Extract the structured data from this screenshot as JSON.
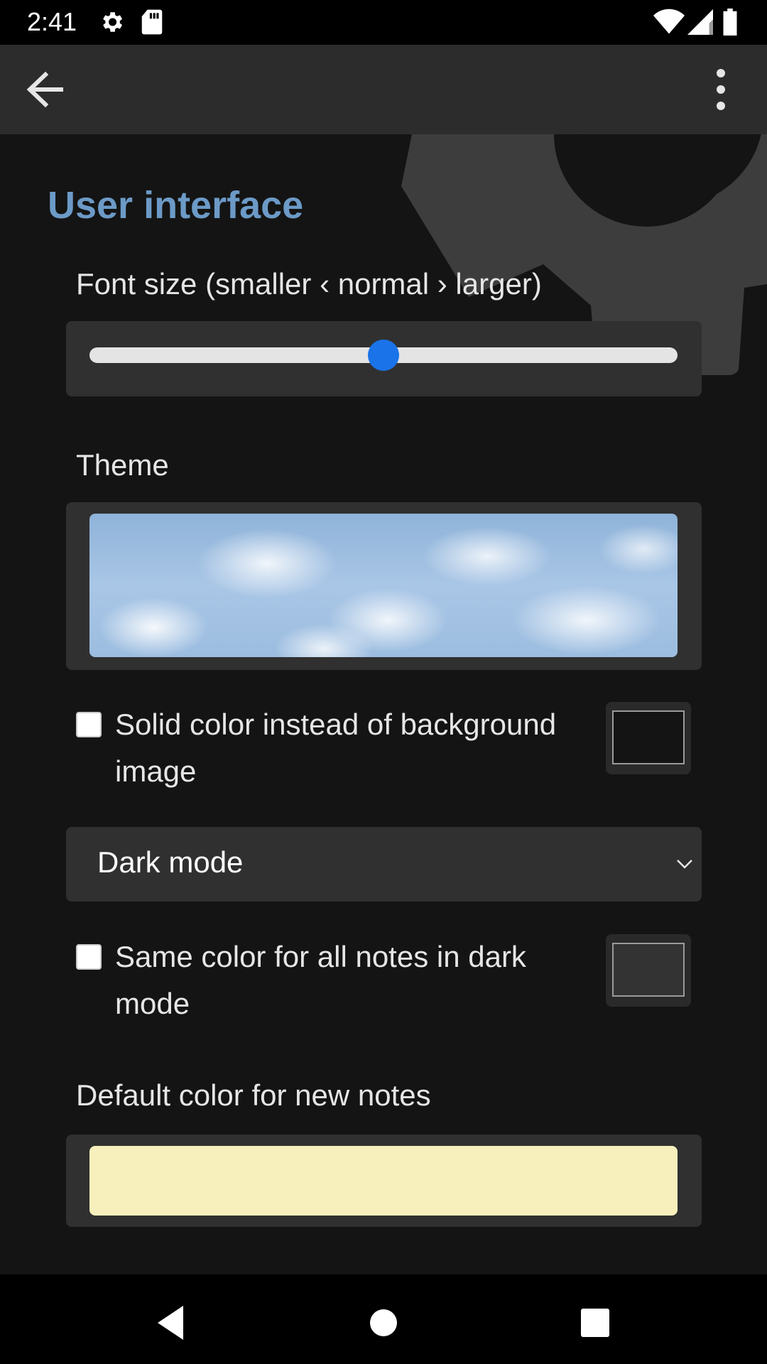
{
  "status_bar": {
    "time": "2:41",
    "icons": [
      "gear-icon",
      "sd-card-icon",
      "wifi-icon",
      "signal-icon",
      "battery-icon"
    ]
  },
  "app_bar": {
    "back_icon": "arrow-left-icon",
    "menu_icon": "more-vert-icon"
  },
  "section": {
    "title": "User interface"
  },
  "font_size": {
    "label": "Font size (smaller ‹ normal › larger)",
    "value_fraction": 0.5
  },
  "theme": {
    "label": "Theme",
    "image": "clouds-sky"
  },
  "solid_color": {
    "label": "Solid color instead of background image",
    "checked": false,
    "swatch_color": "#141414"
  },
  "mode_select": {
    "value": "Dark mode"
  },
  "same_color": {
    "label": "Same color for all notes in dark mode",
    "checked": false,
    "swatch_color": "#333333"
  },
  "default_color": {
    "label": "Default color for new notes",
    "color": "#f8f0bc"
  },
  "colors": {
    "accent": "#6c9ac7",
    "slider_thumb": "#1a73e8",
    "background": "#141414",
    "panel": "#303030"
  },
  "nav_bar": {
    "icons": [
      "nav-back-icon",
      "nav-home-icon",
      "nav-recents-icon"
    ]
  }
}
